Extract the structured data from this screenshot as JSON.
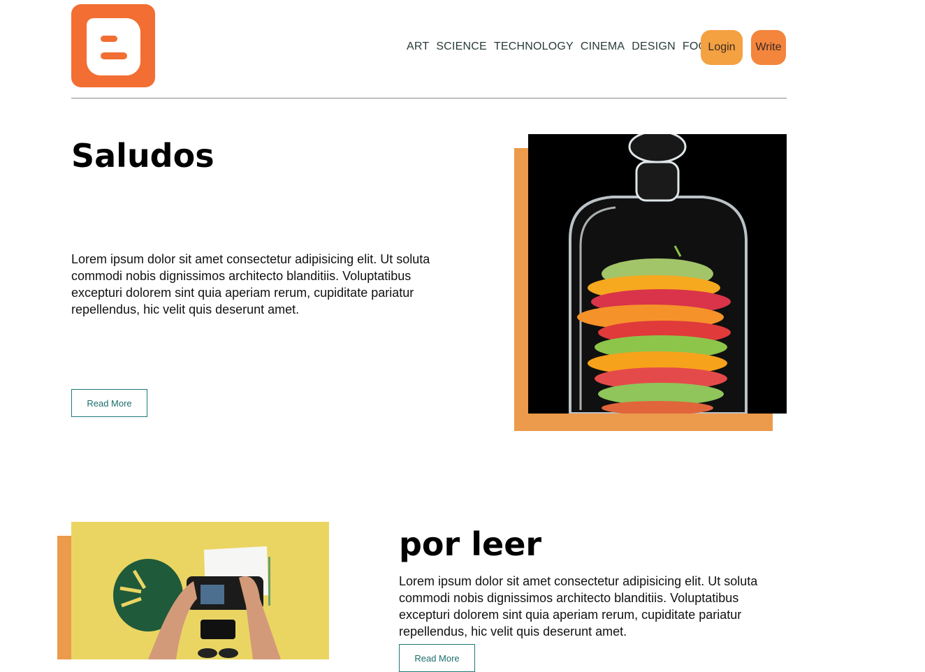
{
  "header": {
    "logo_name": "blogger-logo",
    "nav": [
      "ART",
      "SCIENCE",
      "TECHNOLOGY",
      "CINEMA",
      "DESIGN",
      "FOOD"
    ],
    "login_label": "Login",
    "write_label": "Write"
  },
  "posts": [
    {
      "title": "Saludos",
      "body": "Lorem ipsum dolor sit amet consectetur adipisicing elit. Ut soluta commodi nobis dignissimos architecto blanditiis. Voluptatibus excepturi dolorem sint quia aperiam rerum, cupiditate pariatur repellendus, hic velit quis deserunt amet.",
      "read_more": "Read More",
      "image": "fruit-under-glass-cloche"
    },
    {
      "title": "por leer",
      "body": "Lorem ipsum dolor sit amet consectetur adipisicing elit. Ut soluta commodi nobis dignissimos architecto blanditiis. Voluptatibus excepturi dolorem sint quia aperiam rerum, cupiditate pariatur repellendus, hic velit quis deserunt amet.",
      "read_more": "Read More",
      "image": "hands-holding-camera-yellow-background"
    }
  ],
  "colors": {
    "logo": "#f26e32",
    "login_button": "#f4a142",
    "write_button": "#f4853d",
    "accent_block": "#ec9a4c",
    "button_border": "#1b7a78"
  }
}
